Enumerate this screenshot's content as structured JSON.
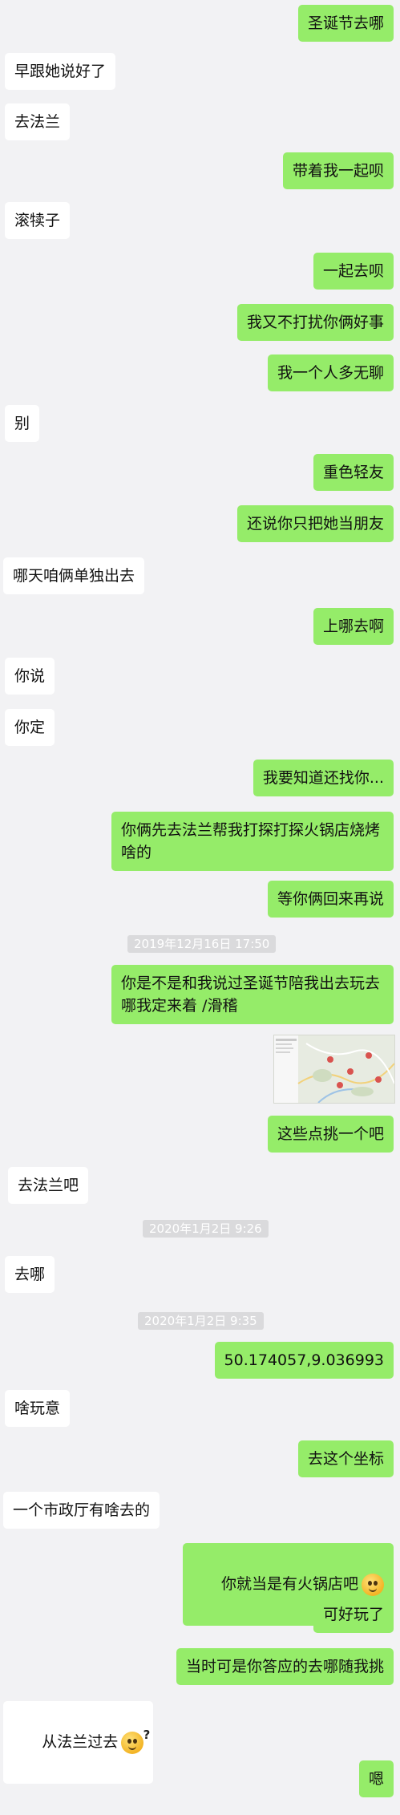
{
  "messages": [
    {
      "side": "out",
      "text": "圣诞节去哪"
    },
    {
      "side": "in",
      "text": "早跟她说好了"
    },
    {
      "side": "in",
      "text": "去法兰"
    },
    {
      "side": "out",
      "text": "带着我一起呗"
    },
    {
      "side": "in",
      "text": "滚犊子"
    },
    {
      "side": "out",
      "text": "一起去呗"
    },
    {
      "side": "out",
      "text": "我又不打扰你俩好事"
    },
    {
      "side": "out",
      "text": "我一个人多无聊"
    },
    {
      "side": "in",
      "text": "别"
    },
    {
      "side": "out",
      "text": "重色轻友"
    },
    {
      "side": "out",
      "text": "还说你只把她当朋友"
    },
    {
      "side": "in",
      "text": "哪天咱俩单独出去"
    },
    {
      "side": "out",
      "text": "上哪去啊"
    },
    {
      "side": "in",
      "text": "你说"
    },
    {
      "side": "in",
      "text": "你定"
    },
    {
      "side": "out",
      "text": "我要知道还找你..."
    },
    {
      "side": "out",
      "text": "你俩先去法兰帮我打探打探火锅店烧烤啥的"
    },
    {
      "side": "out",
      "text": "等你俩回来再说"
    },
    {
      "side": "ts",
      "text": "2019年12月16日 17:50"
    },
    {
      "side": "out",
      "text": "你是不是和我说过圣诞节陪我出去玩去哪我定来着 /滑稽"
    },
    {
      "side": "img",
      "text": ""
    },
    {
      "side": "out",
      "text": "这些点挑一个吧"
    },
    {
      "side": "in",
      "text": "去法兰吧"
    },
    {
      "side": "ts",
      "text": "2020年1月2日 9:26"
    },
    {
      "side": "in",
      "text": "去哪"
    },
    {
      "side": "ts",
      "text": "2020年1月2日 9:35"
    },
    {
      "side": "out",
      "text": "50.174057,9.036993"
    },
    {
      "side": "in",
      "text": "啥玩意"
    },
    {
      "side": "out",
      "text": "去这个坐标"
    },
    {
      "side": "in",
      "text": "一个市政厅有啥去的"
    },
    {
      "side": "out",
      "text": "你就当是有火锅店吧",
      "emoji": "smile-emoji"
    },
    {
      "side": "out",
      "text": "可好玩了"
    },
    {
      "side": "out",
      "text": "当时可是你答应的去哪随我挑"
    },
    {
      "side": "in",
      "text": "从法兰过去",
      "emoji": "confused-emoji"
    },
    {
      "side": "out",
      "text": "嗯"
    }
  ],
  "colors": {
    "background": "#f2f2f4",
    "incoming_bubble": "#ffffff",
    "outgoing_bubble": "#95ec69",
    "timestamp_bg": "#dadadc"
  }
}
